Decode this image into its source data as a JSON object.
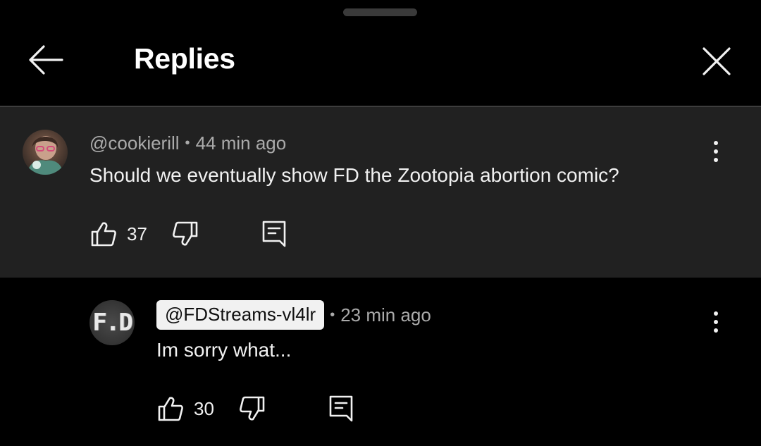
{
  "header": {
    "title": "Replies",
    "back_icon": "arrow-left-icon",
    "close_icon": "close-icon"
  },
  "colors": {
    "background": "#000000",
    "parent_comment_bg": "#212121",
    "notification_dot": "#ff0033",
    "text_primary": "#f1f1f1",
    "text_secondary": "#aaaaaa"
  },
  "comments": [
    {
      "author": "@cookierill",
      "separator": "•",
      "time": "44 min ago",
      "text": "Should we eventually show FD the Zootopia abortion comic?",
      "likes": "37"
    },
    {
      "author": "@FDStreams-vl4lr",
      "author_is_creator": true,
      "avatar_text": "F.D",
      "separator": "•",
      "time": "23 min ago",
      "text": "Im sorry what...",
      "likes": "30"
    }
  ]
}
